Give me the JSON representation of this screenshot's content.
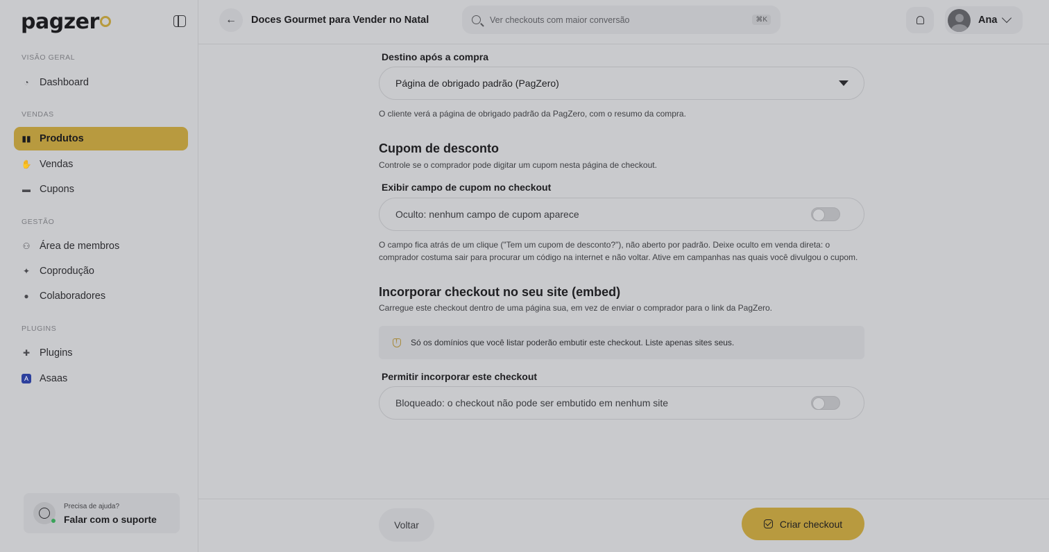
{
  "brand": {
    "logo_text": "pagzer",
    "logo_suffix_color": "#b79a3d",
    "accent": "#b89a3f"
  },
  "sidebar": {
    "sections": [
      {
        "title": "VISÃO GERAL",
        "items": [
          {
            "label": "Dashboard",
            "icon": "dashboard-icon"
          }
        ]
      },
      {
        "title": "VENDAS",
        "items": [
          {
            "label": "Produtos",
            "icon": "products-icon",
            "active": true
          },
          {
            "label": "Vendas",
            "icon": "sales-icon"
          },
          {
            "label": "Cupons",
            "icon": "coupon-icon"
          }
        ]
      },
      {
        "title": "GESTÃO",
        "items": [
          {
            "label": "Área de membros",
            "icon": "members-icon"
          },
          {
            "label": "Coprodução",
            "icon": "handshake-icon"
          },
          {
            "label": "Colaboradores",
            "icon": "user-icon"
          }
        ]
      },
      {
        "title": "PLUGINS",
        "items": [
          {
            "label": "Plugins",
            "icon": "puzzle-icon"
          },
          {
            "label": "Asaas",
            "icon": "asaas-icon"
          }
        ]
      }
    ],
    "help": {
      "small": "Precisa de ajuda?",
      "big": "Falar com o suporte"
    }
  },
  "topbar": {
    "title": "Doces Gourmet para Vender no Natal",
    "search_placeholder": "Ver checkouts com maior conversão",
    "shortcut": "⌘K",
    "user_name": "Ana"
  },
  "main": {
    "destination": {
      "label": "Destino após a compra",
      "value": "Página de obrigado padrão (PagZero)",
      "hint": "O cliente verá a página de obrigado padrão da PagZero, com o resumo da compra."
    },
    "coupon": {
      "heading": "Cupom de desconto",
      "subtitle": "Controle se o comprador pode digitar um cupom nesta página de checkout.",
      "label": "Exibir campo de cupom no checkout",
      "toggle_text": "Oculto: nenhum campo de cupom aparece",
      "toggle_on": false,
      "hint": "O campo fica atrás de um clique (\"Tem um cupom de desconto?\"), não aberto por padrão. Deixe oculto em venda direta: o comprador costuma sair para procurar um código na internet e não voltar. Ative em campanhas nas quais você divulgou o cupom."
    },
    "embed": {
      "heading": "Incorporar checkout no seu site (embed)",
      "subtitle": "Carregue este checkout dentro de uma página sua, em vez de enviar o comprador para o link da PagZero.",
      "notice": "Só os domínios que você listar poderão embutir este checkout. Liste apenas sites seus.",
      "label": "Permitir incorporar este checkout",
      "toggle_text": "Bloqueado: o checkout não pode ser embutido em nenhum site",
      "toggle_on": false
    }
  },
  "footer": {
    "back_label": "Voltar",
    "create_label": "Criar checkout"
  }
}
